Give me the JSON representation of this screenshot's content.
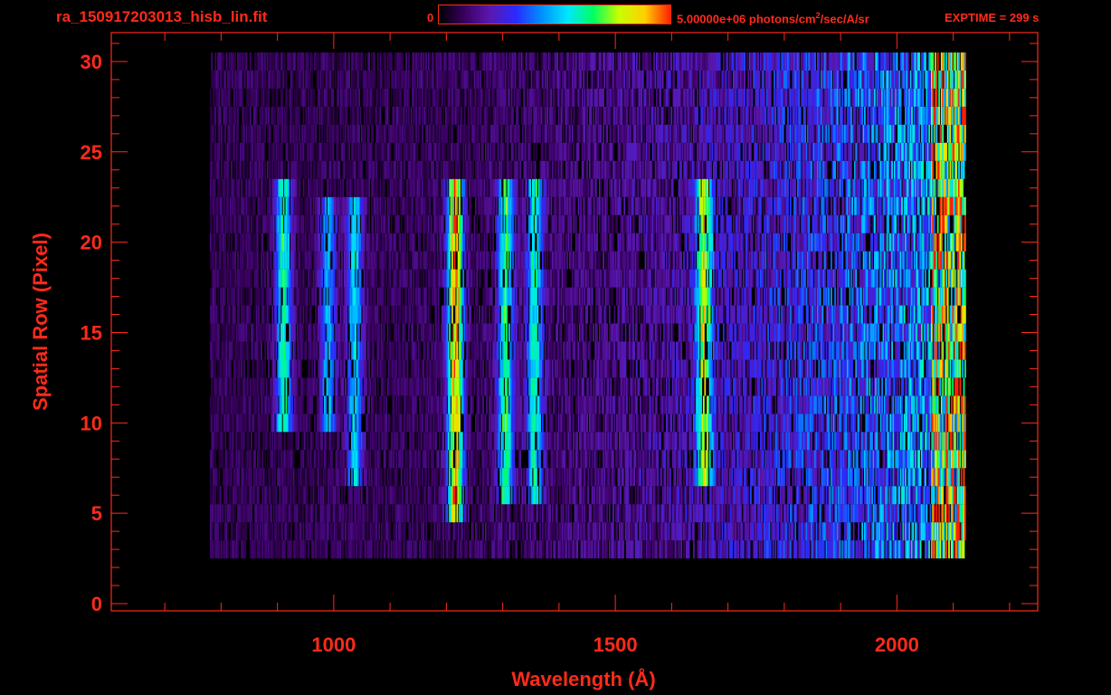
{
  "header": {
    "file_title": "ra_150917203013_hisb_lin.fit",
    "colorbar_min": "0",
    "colorbar_max_value": "5.00000e+06 photons/cm",
    "colorbar_max_exp": "2",
    "colorbar_max_unit": "/sec/A/sr",
    "exptime": "EXPTIME = 299 s"
  },
  "colors": {
    "axes": "#ff2a1a",
    "background": "#000000",
    "colormap": [
      "#000000",
      "#3a0060",
      "#5a18b0",
      "#2a2aff",
      "#0090ff",
      "#00e6ff",
      "#00ff60",
      "#c8ff00",
      "#ffd000",
      "#ff2000"
    ]
  },
  "chart_data": {
    "type": "heatmap",
    "xlabel": "Wavelength (Å)",
    "ylabel": "Spatial Row (Pixel)",
    "x_ticks": [
      "1000",
      "1500",
      "2000"
    ],
    "y_ticks": [
      "0",
      "5",
      "10",
      "15",
      "20",
      "25",
      "30"
    ],
    "xlim": [
      605,
      2250
    ],
    "ylim": [
      -0.4,
      31.6
    ],
    "y_tick_values": [
      0,
      5,
      10,
      15,
      20,
      25,
      30
    ],
    "x_tick_values": [
      1000,
      1500,
      2000
    ],
    "minor_x_step": 100,
    "minor_y_step": 1,
    "colorbar_range": [
      0,
      5000000
    ],
    "rows": 31,
    "data_rows_range": [
      3,
      30
    ],
    "wavelength_range": [
      780,
      2120
    ],
    "features": [
      {
        "label": "emission",
        "center": 1215,
        "rows": [
          5,
          23
        ],
        "peak": 0.85
      },
      {
        "label": "emission",
        "center": 1304,
        "rows": [
          6,
          23
        ],
        "peak": 0.55
      },
      {
        "label": "emission",
        "center": 1356,
        "rows": [
          6,
          23
        ],
        "peak": 0.5
      },
      {
        "label": "emission",
        "center": 1657,
        "rows": [
          7,
          23
        ],
        "peak": 0.6
      },
      {
        "label": "emission",
        "center": 1036,
        "rows": [
          7,
          22
        ],
        "peak": 0.45
      },
      {
        "label": "emission",
        "center": 989,
        "rows": [
          10,
          22
        ],
        "peak": 0.4
      },
      {
        "label": "emission",
        "center": 910,
        "rows": [
          10,
          23
        ],
        "peak": 0.55
      }
    ]
  }
}
